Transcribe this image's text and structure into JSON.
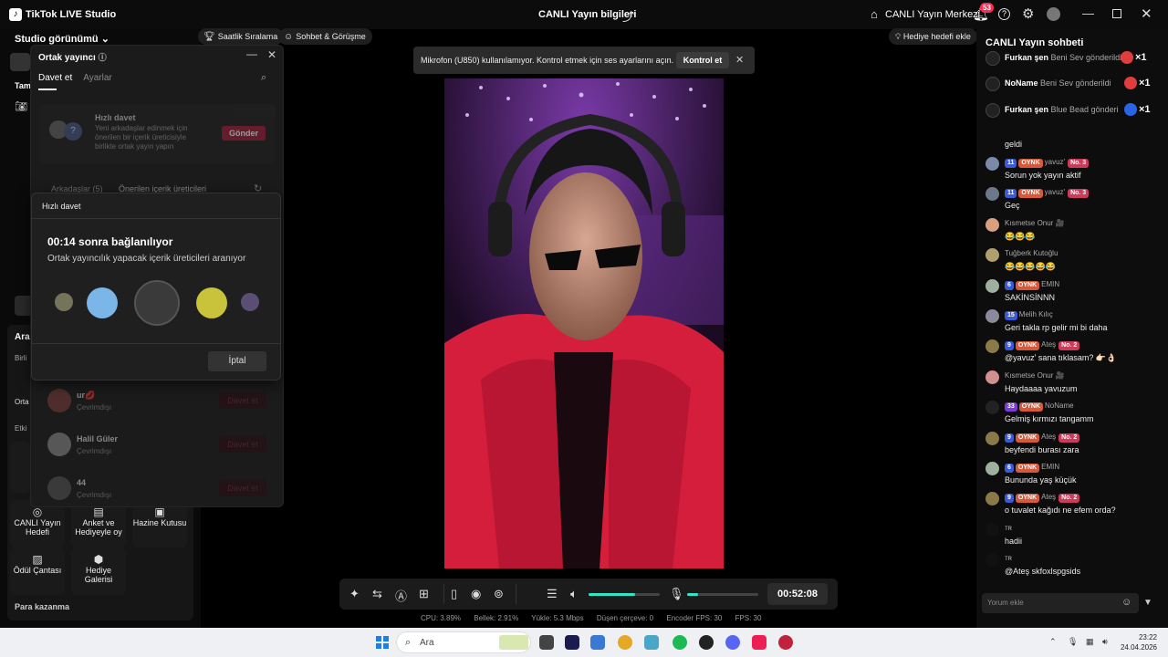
{
  "app": {
    "name": "TikTok LIVE Studio",
    "center_title": "CANLI Yayın bilgileri",
    "live_center": "CANLI Yayın Merkezi",
    "notif_count": "53"
  },
  "left": {
    "studio_view": "Studio görünümü",
    "tab_partial": "Tam",
    "section_partial_1": "Ara",
    "section_partial_2": "Birli",
    "section_partial_3": "Orta",
    "section_partial_4": "Etki",
    "tools": [
      {
        "label": "CANLI Yayın Hedefi",
        "icon": "target-icon"
      },
      {
        "label": "Anket ve Hediyeyle oy",
        "icon": "poll-icon"
      },
      {
        "label": "Hazine Kutusu",
        "icon": "treasure-icon"
      },
      {
        "label": "Ödül Çantası",
        "icon": "bag-icon"
      },
      {
        "label": "Hediye Galerisi",
        "icon": "gift-gallery-icon"
      }
    ],
    "para_kazanma": "Para kazanma"
  },
  "chips": {
    "hourly_rank": "Saatlik Sıralama",
    "chat_meet": "Sohbet & Görüşme",
    "gift_goal": "Hediye hedefi ekle"
  },
  "cohost": {
    "title": "Ortak yayıncı",
    "tabs": [
      "Davet et",
      "Ayarlar"
    ],
    "quick_title": "Hızlı davet",
    "quick_desc": "Yeni arkadaşlar edinmek için önerilen bir içerik üreticisiyle birlikte ortak yayın yapın",
    "send": "Gönder",
    "friends_tab": "Arkadaşlar (5)",
    "suggested_tab": "Önerilen içerik üreticileri",
    "friends": [
      {
        "name": "ur💋",
        "status": "Çevrimdışı",
        "button": "Davet et"
      },
      {
        "name": "Halil Güler",
        "status": "Çevrimdışı",
        "button": "Davet et"
      },
      {
        "name": "44",
        "status": "Çevrimdışı",
        "button": "Davet et"
      }
    ]
  },
  "quick_dialog": {
    "header": "Hızlı davet",
    "title": "00:14 sonra bağlanılıyor",
    "subtitle": "Ortak yayıncılık yapacak içerik üreticileri aranıyor",
    "cancel": "İptal"
  },
  "notice": {
    "text": "Mikrofon (U850) kullanılamıyor. Kontrol etmek için ses ayarlarını açın.",
    "button": "Kontrol et"
  },
  "controls": {
    "timer": "00:52:08",
    "volume_level": 0.65,
    "mic_level": 0.15
  },
  "stats": {
    "cpu": "CPU: 3.89%",
    "mem": "Bellek: 2.91%",
    "upload": "Yükle: 5.3 Mbps",
    "dropped": "Düşen çerçeve: 0",
    "enc_fps": "Encoder FPS: 30",
    "fps": "FPS: 30"
  },
  "chat": {
    "title": "CANLI Yayın sohbeti",
    "gifts": [
      {
        "name": "Furkan şen",
        "text": "Beni Sev gönderildi",
        "count": "×1"
      },
      {
        "name": "NoName",
        "text": "Beni Sev gönderildi",
        "count": "×1"
      },
      {
        "name": "Furkan şen",
        "text": "Blue Bead gönderi",
        "count": "×1"
      }
    ],
    "partial_msg": "geldi",
    "messages": [
      {
        "lvl": "11",
        "club": "OYNK",
        "user": "yavuz'",
        "rank": "No. 3",
        "text": "Sorun yok yayın aktif"
      },
      {
        "lvl": "11",
        "club": "OYNK",
        "user": "yavuz'",
        "rank": "No. 3",
        "text": "Geç"
      },
      {
        "lvl": "",
        "club": "",
        "user": "Kısmetse Onur 🎥",
        "rank": "",
        "text": "😂😂😂"
      },
      {
        "lvl": "",
        "club": "",
        "user": "Tuğberk Kutoğlu",
        "rank": "",
        "text": "😂😂😂😂😂"
      },
      {
        "lvl": "6",
        "club": "OYNK",
        "user": "EMIN",
        "rank": "",
        "text": "SAKİNSİNNN"
      },
      {
        "lvl": "15",
        "club": "",
        "user": "Melih Kılıç",
        "rank": "",
        "text": "Geri takla rp gelir mi bi daha"
      },
      {
        "lvl": "9",
        "club": "OYNK",
        "user": "Ateş",
        "rank": "No. 2",
        "text": "@yavuz' sana tıklasam? 👉🏻👌🏻"
      },
      {
        "lvl": "",
        "club": "",
        "user": "Kısmetse Onur 🎥",
        "rank": "",
        "text": "Haydaaaa yavuzum"
      },
      {
        "lvl": "33",
        "club": "OYNK",
        "user": "NoName",
        "rank": "",
        "text": "Gelmiş kırmızı tangamm"
      },
      {
        "lvl": "9",
        "club": "OYNK",
        "user": "Ateş",
        "rank": "No. 2",
        "text": "beyfendi burası zara"
      },
      {
        "lvl": "6",
        "club": "OYNK",
        "user": "EMIN",
        "rank": "",
        "text": "Bununda yaş küçük"
      },
      {
        "lvl": "9",
        "club": "OYNK",
        "user": "Ateş",
        "rank": "No. 2",
        "text": "o tuvalet kağıdı ne efem orda?"
      },
      {
        "lvl": "",
        "club": "",
        "user": "ᴛʀ",
        "rank": "",
        "text": "hadii"
      },
      {
        "lvl": "",
        "club": "",
        "user": "ᴛʀ",
        "rank": "",
        "text": "@Ateş skfoxlspgsids"
      }
    ],
    "input_placeholder": "Yorum ekle"
  },
  "taskbar": {
    "search": "Ara",
    "time": "23:22",
    "date": "24.04.2026"
  }
}
